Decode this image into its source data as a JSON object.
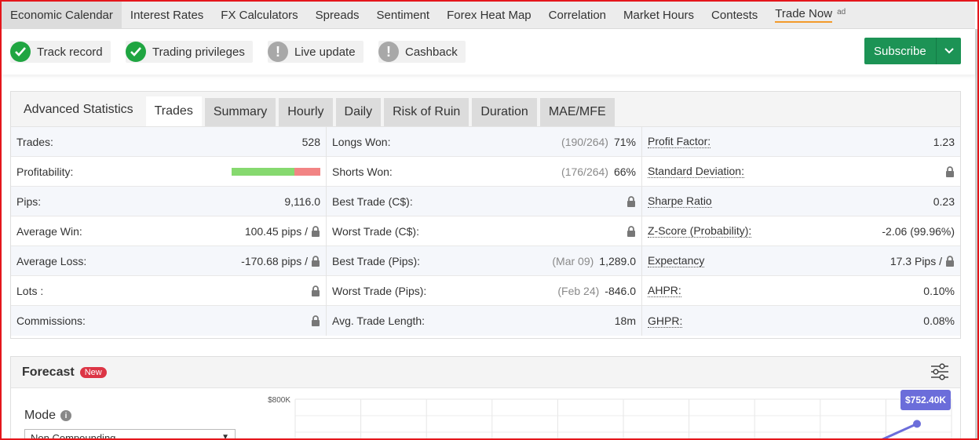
{
  "nav": {
    "items": [
      "Economic Calendar",
      "Interest Rates",
      "FX Calculators",
      "Spreads",
      "Sentiment",
      "Forex Heat Map",
      "Correlation",
      "Market Hours",
      "Contests"
    ],
    "trade_now": "Trade Now",
    "ad": "ad"
  },
  "badges": {
    "track_record": "Track record",
    "trading_privileges": "Trading privileges",
    "live_update": "Live update",
    "cashback": "Cashback"
  },
  "subscribe_label": "Subscribe",
  "stats": {
    "title": "Advanced Statistics",
    "tabs": [
      "Trades",
      "Summary",
      "Hourly",
      "Daily",
      "Risk of Ruin",
      "Duration",
      "MAE/MFE"
    ],
    "col1": {
      "trades_label": "Trades:",
      "trades_value": "528",
      "profitability_label": "Profitability:",
      "profitability_win_fraction": 0.71,
      "pips_label": "Pips:",
      "pips_value": "9,116.0",
      "avg_win_label": "Average Win:",
      "avg_win_value": "100.45 pips /",
      "avg_loss_label": "Average Loss:",
      "avg_loss_value": "-170.68 pips /",
      "lots_label": "Lots :",
      "commissions_label": "Commissions:"
    },
    "col2": {
      "longs_won_label": "Longs Won:",
      "longs_won_detail": "(190/264)",
      "longs_won_value": "71%",
      "shorts_won_label": "Shorts Won:",
      "shorts_won_detail": "(176/264)",
      "shorts_won_value": "66%",
      "best_trade_cs_label": "Best Trade (C$):",
      "worst_trade_cs_label": "Worst Trade (C$):",
      "best_trade_pips_label": "Best Trade (Pips):",
      "best_trade_pips_date": "(Mar 09)",
      "best_trade_pips_value": "1,289.0",
      "worst_trade_pips_label": "Worst Trade (Pips):",
      "worst_trade_pips_date": "(Feb 24)",
      "worst_trade_pips_value": "-846.0",
      "avg_length_label": "Avg. Trade Length:",
      "avg_length_value": "18m"
    },
    "col3": {
      "profit_factor_label": "Profit Factor:",
      "profit_factor_value": "1.23",
      "std_dev_label": "Standard Deviation:",
      "sharpe_label": "Sharpe Ratio",
      "sharpe_value": "0.23",
      "zscore_label": "Z-Score (Probability):",
      "zscore_value": "-2.06 (99.96%)",
      "expectancy_label": "Expectancy",
      "expectancy_value": "17.3 Pips /",
      "ahpr_label": "AHPR:",
      "ahpr_value": "0.10%",
      "ghpr_label": "GHPR:",
      "ghpr_value": "0.08%"
    }
  },
  "forecast": {
    "title": "Forecast",
    "new_badge": "New",
    "mode_label": "Mode",
    "mode_value": "Non Compounding",
    "y_tick_top": "$800K",
    "tooltip": "$752.40K",
    "point_y_fraction": 0.94
  },
  "colors": {
    "accent_green": "#1c9355",
    "check_green": "#1fa541",
    "profit_win": "#86d96f",
    "profit_loss": "#f28484",
    "forecast_line": "#6b6dda",
    "new_badge": "#dc3545"
  }
}
